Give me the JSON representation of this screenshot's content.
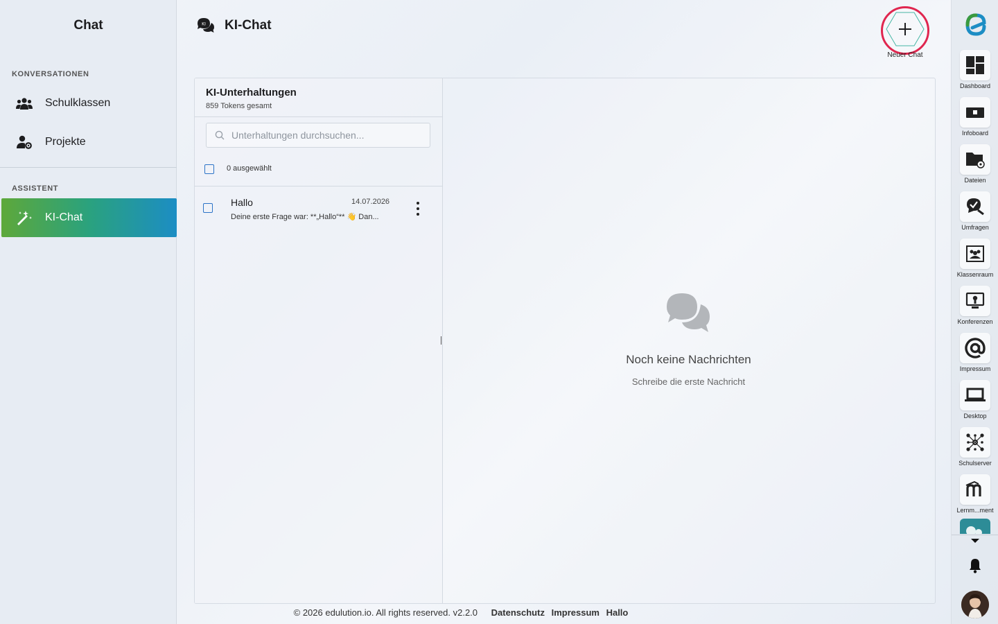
{
  "sidebar": {
    "title": "Chat",
    "sections": [
      {
        "label": "KONVERSATIONEN",
        "items": [
          {
            "label": "Schulklassen",
            "icon": "group-icon"
          },
          {
            "label": "Projekte",
            "icon": "user-settings-icon"
          }
        ]
      },
      {
        "label": "ASSISTENT",
        "items": [
          {
            "label": "KI-Chat",
            "icon": "magic-wand-icon",
            "active": true
          }
        ]
      }
    ]
  },
  "header": {
    "title": "KI-Chat",
    "new_chat_label": "Neuer Chat",
    "icon_badge": "KI"
  },
  "conversations": {
    "title": "KI-Unterhaltungen",
    "subtitle": "859 Tokens gesamt",
    "search_placeholder": "Unterhaltungen durchsuchen...",
    "selected_label": "0 ausgewählt",
    "items": [
      {
        "name": "Hallo",
        "date": "14.07.2026",
        "preview": "Deine erste Frage war: **„Hallo“** 👋 Dan..."
      }
    ]
  },
  "empty_state": {
    "title": "Noch keine Nachrichten",
    "subtitle": "Schreibe die erste Nachricht"
  },
  "footer": {
    "copyright": "© 2026 edulution.io. All rights reserved. v2.2.0",
    "links": [
      "Datenschutz",
      "Impressum",
      "Hallo"
    ]
  },
  "rail": {
    "apps": [
      {
        "label": "Dashboard",
        "icon": "dashboard-icon"
      },
      {
        "label": "Infoboard",
        "icon": "infoboard-icon"
      },
      {
        "label": "Dateien",
        "icon": "folder-share-icon"
      },
      {
        "label": "Umfragen",
        "icon": "survey-icon"
      },
      {
        "label": "Klassenraum",
        "icon": "classroom-icon"
      },
      {
        "label": "Konferenzen",
        "icon": "conference-icon"
      },
      {
        "label": "Impressum",
        "icon": "at-sign-icon"
      },
      {
        "label": "Desktop",
        "icon": "laptop-icon"
      },
      {
        "label": "Schulserver",
        "icon": "network-icon"
      },
      {
        "label": "Lernm...ment",
        "icon": "moodle-icon"
      }
    ]
  },
  "colors": {
    "accent_gradient": [
      "#5ea83a",
      "#2aa27e",
      "#1c8dc4"
    ],
    "new_chat_ring": "#e0264f",
    "checkbox": "#2b73c7",
    "logo": [
      "#3a9a3f",
      "#1c7fc4"
    ]
  }
}
